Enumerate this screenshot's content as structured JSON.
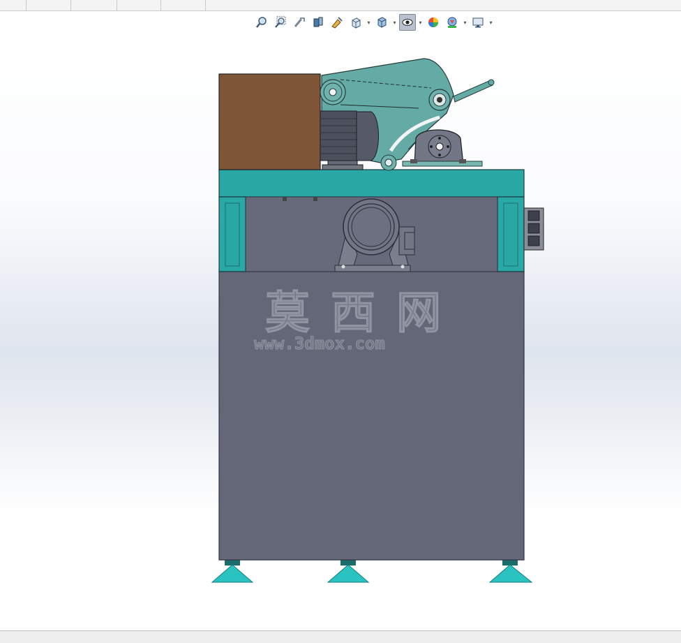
{
  "document_tabs": [
    "",
    "",
    "",
    "",
    ""
  ],
  "heads_up_toolbar": {
    "buttons": [
      {
        "name": "zoom-to-fit-icon"
      },
      {
        "name": "zoom-to-area-icon"
      },
      {
        "name": "previous-view-icon"
      },
      {
        "name": "section-view-icon"
      },
      {
        "name": "dynamic-annotation-views-icon"
      },
      {
        "name": "view-orientation-icon",
        "dropdown": true
      },
      {
        "name": "display-style-icon",
        "dropdown": true
      },
      {
        "name": "hide-show-items-icon",
        "dropdown": true,
        "active": true
      },
      {
        "name": "edit-appearance-icon"
      },
      {
        "name": "apply-scene-icon",
        "dropdown": true
      },
      {
        "name": "view-settings-icon",
        "dropdown": true
      }
    ]
  },
  "watermark": {
    "chinese": "莫西网",
    "url": "www.3dmox.com"
  },
  "colors": {
    "frame_teal": "#2aa8a6",
    "cabinet_gray": "#636778",
    "guard_teal": "#64aaa5",
    "motor_box_brown": "#7f5538",
    "motor_dark": "#4b505c",
    "feet_teal": "#2bc2c2"
  }
}
